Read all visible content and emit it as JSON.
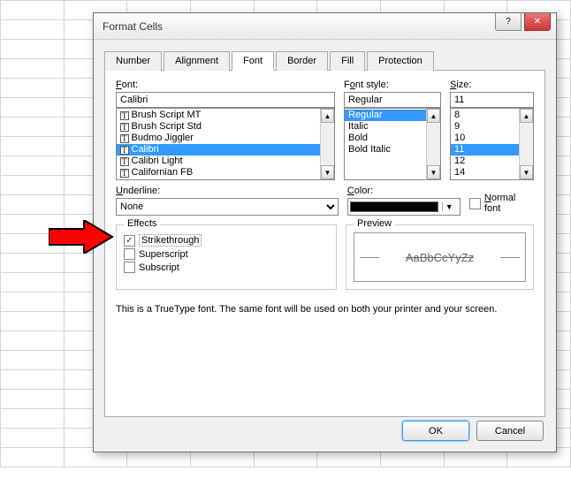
{
  "dialog": {
    "title": "Format Cells"
  },
  "tabs": {
    "number": "Number",
    "alignment": "Alignment",
    "font": "Font",
    "border": "Border",
    "fill": "Fill",
    "protection": "Protection"
  },
  "font": {
    "label": "Font:",
    "value": "Calibri",
    "items": [
      "Brush Script MT",
      "Brush Script Std",
      "Budmo Jiggler",
      "Calibri",
      "Calibri Light",
      "Californian FB"
    ],
    "selectedIndex": 3
  },
  "style": {
    "label": "Font style:",
    "value": "Regular",
    "items": [
      "Regular",
      "Italic",
      "Bold",
      "Bold Italic"
    ],
    "selectedIndex": 0
  },
  "size": {
    "label": "Size:",
    "value": "11",
    "items": [
      "8",
      "9",
      "10",
      "11",
      "12",
      "14"
    ],
    "selectedIndex": 3
  },
  "underline": {
    "label": "Underline:",
    "value": "None"
  },
  "color": {
    "label": "Color:",
    "value": "#000000"
  },
  "normalfont": {
    "label": "Normal font",
    "checked": false
  },
  "effects": {
    "legend": "Effects",
    "strike": {
      "label": "Strikethrough",
      "checked": true
    },
    "super": {
      "label": "Superscript",
      "checked": false
    },
    "sub": {
      "label": "Subscript",
      "checked": false
    }
  },
  "preview": {
    "legend": "Preview",
    "sample": "AaBbCcYyZz"
  },
  "footnote": "This is a TrueType font.  The same font will be used on both your printer and your screen.",
  "buttons": {
    "ok": "OK",
    "cancel": "Cancel"
  }
}
